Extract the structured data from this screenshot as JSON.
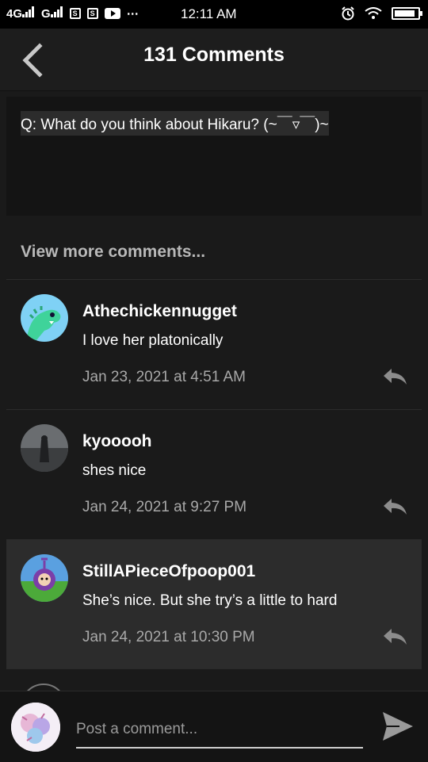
{
  "status_bar": {
    "network_left": "4G",
    "network_right": "G",
    "time": "12:11 AM",
    "battery_level": 0.9,
    "more_icon": "⋯"
  },
  "header": {
    "back_icon": "chevron-left-icon",
    "title": "131 Comments"
  },
  "question": {
    "text": "Q: What do you think about Hikaru? (~￣▿￣)~"
  },
  "view_more_label": "View more comments...",
  "comments": [
    {
      "user": "Athechickennugget",
      "text": "I love her platonically",
      "date": "Jan 23, 2021 at 4:51 AM"
    },
    {
      "user": "kyooooh",
      "text": "shes nice",
      "date": "Jan 24, 2021 at 9:27 PM"
    },
    {
      "user": "StillAPieceOfpoop001",
      "text": "She’s nice. But she try’s a little to hard",
      "date": "Jan 24, 2021 at 10:30 PM"
    }
  ],
  "footer": {
    "placeholder": "Post a comment..."
  },
  "colors": {
    "background": "#1a1a1a",
    "highlight_row": "#2c2c2c",
    "date_text": "#a8a8a8",
    "view_more_text": "#b8b8b8",
    "avatar_green": "#3fd39a"
  }
}
